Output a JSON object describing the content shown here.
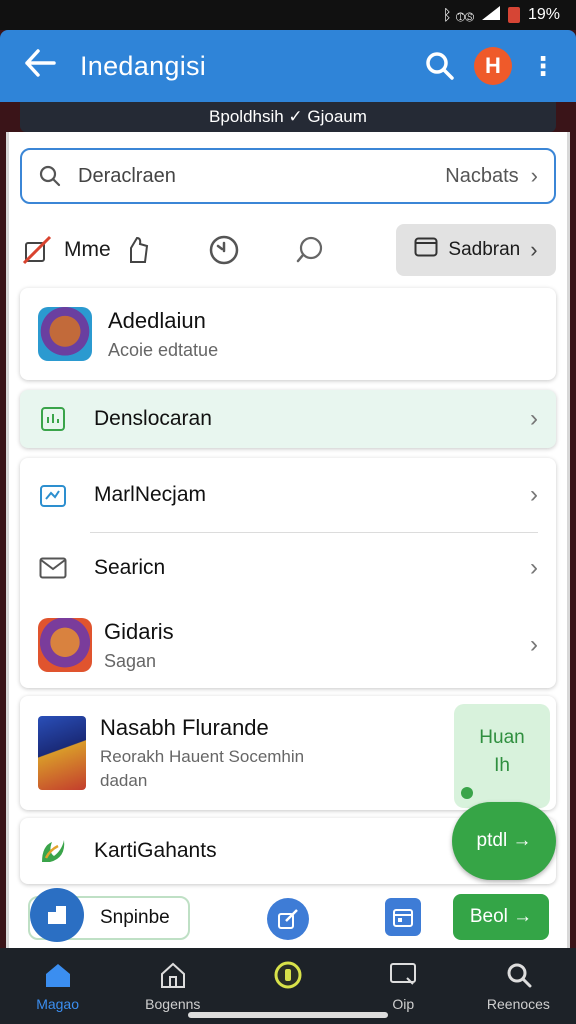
{
  "status_bar": {
    "signal_text": "ᛒ ⓉⓈ",
    "battery_percent": "19%"
  },
  "app_bar": {
    "title": "Inedangisi",
    "brand_glyph": "H"
  },
  "sub_banner": {
    "text": "Bpoldhsih ✓ Gjoaum"
  },
  "search": {
    "value": "Deraclraen",
    "right_text": "Nacbats"
  },
  "chips": {
    "first_label": "Mme",
    "box_label": "Sadbran"
  },
  "card_app": {
    "title": "Adedlaiun",
    "subtitle": "Acoie edtatue"
  },
  "highlight_row": {
    "label": "Denslocaran"
  },
  "list_rows": [
    {
      "label": "MarlNecjam",
      "icon": "picture-frame-icon"
    },
    {
      "label": "Searicn",
      "icon": "mail-icon"
    }
  ],
  "gidaris": {
    "title": "Gidaris",
    "subtitle": "Sagan"
  },
  "promo": {
    "title": "Nasabh Flurande",
    "line1": "Reorakh Hauent Socemhin",
    "line2": "dadan"
  },
  "fab_panel": {
    "line1": "Huan",
    "line2": "Ih"
  },
  "fab_bubble": {
    "label": "ptdl →"
  },
  "karti": {
    "label": "KartiGahants"
  },
  "action_bar": {
    "pill_label": "Snpinbe",
    "go_label": "Beol →"
  },
  "bottom_nav": [
    {
      "label": "Magao",
      "icon": "home-icon",
      "active": true
    },
    {
      "label": "Bogenns",
      "icon": "house-outline-icon",
      "active": false
    },
    {
      "label": "",
      "icon": "circle-badge-icon",
      "active": false
    },
    {
      "label": "Oip",
      "icon": "monitor-icon",
      "active": false
    },
    {
      "label": "Reenoces",
      "icon": "search-gear-icon",
      "active": false
    }
  ],
  "colors": {
    "primary": "#2f84d8",
    "accent_green": "#34a547",
    "brand_orange": "#ef5a2a"
  }
}
